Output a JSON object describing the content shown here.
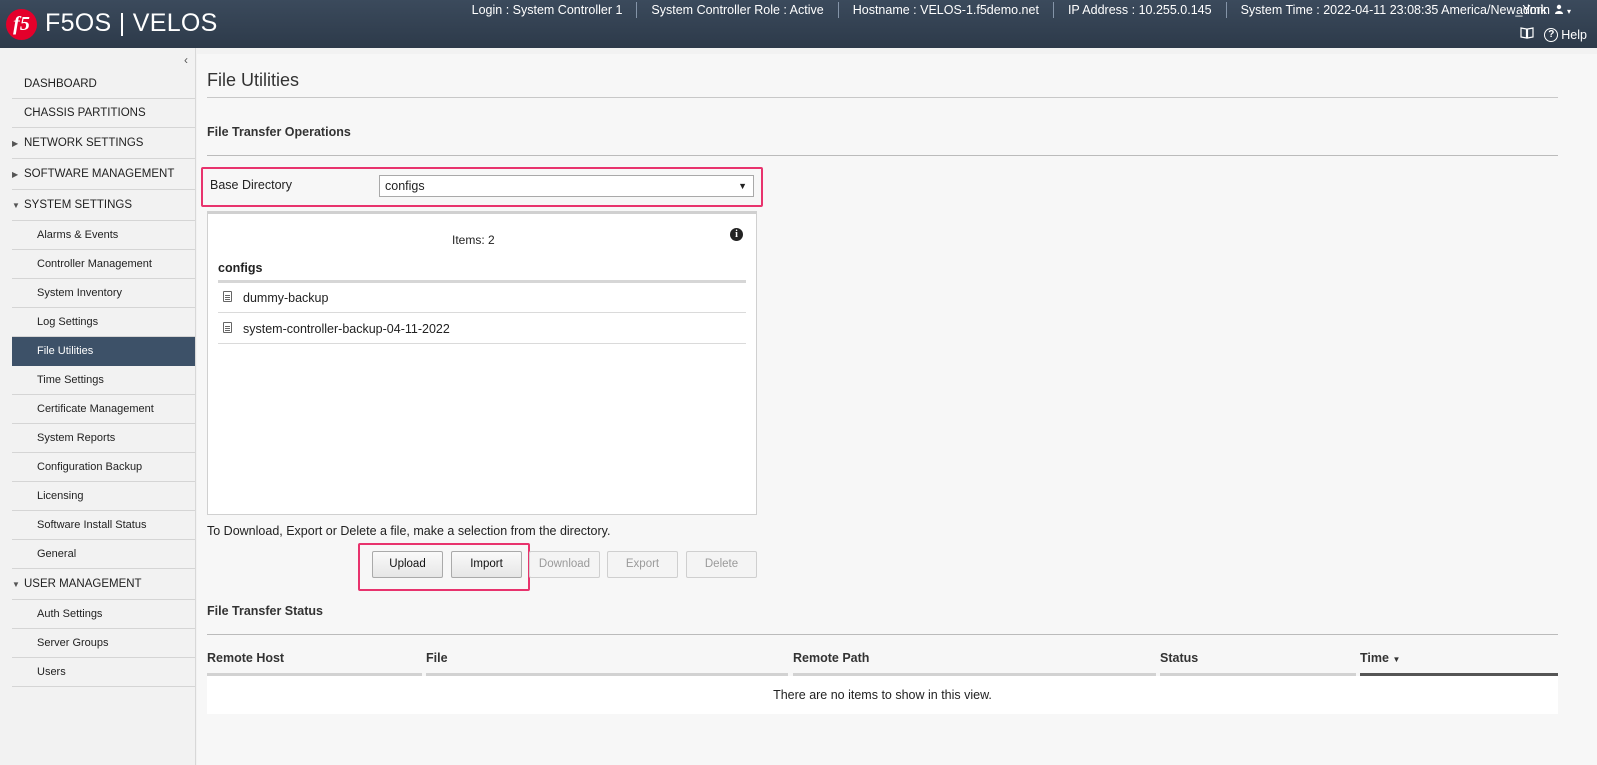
{
  "header": {
    "logo_text": "f5",
    "product": "F5OS | VELOS",
    "login": "Login : System Controller 1",
    "role": "System Controller Role : Active",
    "hostname": "Hostname : VELOS-1.f5demo.net",
    "ip": "IP Address : 10.255.0.145",
    "time": "System Time : 2022-04-11 23:08:35 America/New_York",
    "user": "admin",
    "help": "Help",
    "icons": [
      "user-icon",
      "book-icon",
      "help-icon"
    ]
  },
  "sidebar": {
    "collapse_glyph": "‹",
    "items": [
      {
        "label": "DASHBOARD"
      },
      {
        "label": "CHASSIS PARTITIONS"
      },
      {
        "label": "NETWORK SETTINGS"
      },
      {
        "label": "SOFTWARE MANAGEMENT"
      },
      {
        "label": "SYSTEM SETTINGS"
      },
      {
        "label": "USER MANAGEMENT"
      }
    ],
    "system_settings_children": [
      "Alarms & Events",
      "Controller Management",
      "System Inventory",
      "Log Settings",
      "File Utilities",
      "Time Settings",
      "Certificate Management",
      "System Reports",
      "Configuration Backup",
      "Licensing",
      "Software Install Status",
      "General"
    ],
    "user_management_children": [
      "Auth Settings",
      "Server Groups",
      "Users"
    ],
    "active": "File Utilities"
  },
  "main": {
    "title": "File Utilities",
    "transfer_ops_title": "File Transfer Operations",
    "base_directory_label": "Base Directory",
    "base_directory_value": "configs",
    "items_count": "Items: 2",
    "directory_name": "configs",
    "files": [
      "dummy-backup",
      "system-controller-backup-04-11-2022"
    ],
    "hint": "To Download, Export or Delete a file, make a selection from the directory.",
    "buttons": {
      "upload": "Upload",
      "import": "Import",
      "download": "Download",
      "export": "Export",
      "delete": "Delete"
    },
    "status_title": "File Transfer Status",
    "columns": [
      "Remote Host",
      "File",
      "Remote Path",
      "Status",
      "Time"
    ],
    "empty_message": "There are no items to show in this view."
  },
  "colors": {
    "header_bg": "#33404f",
    "active_nav": "#3d5168",
    "highlight": "#e8336d",
    "logo": "#e4002b"
  }
}
